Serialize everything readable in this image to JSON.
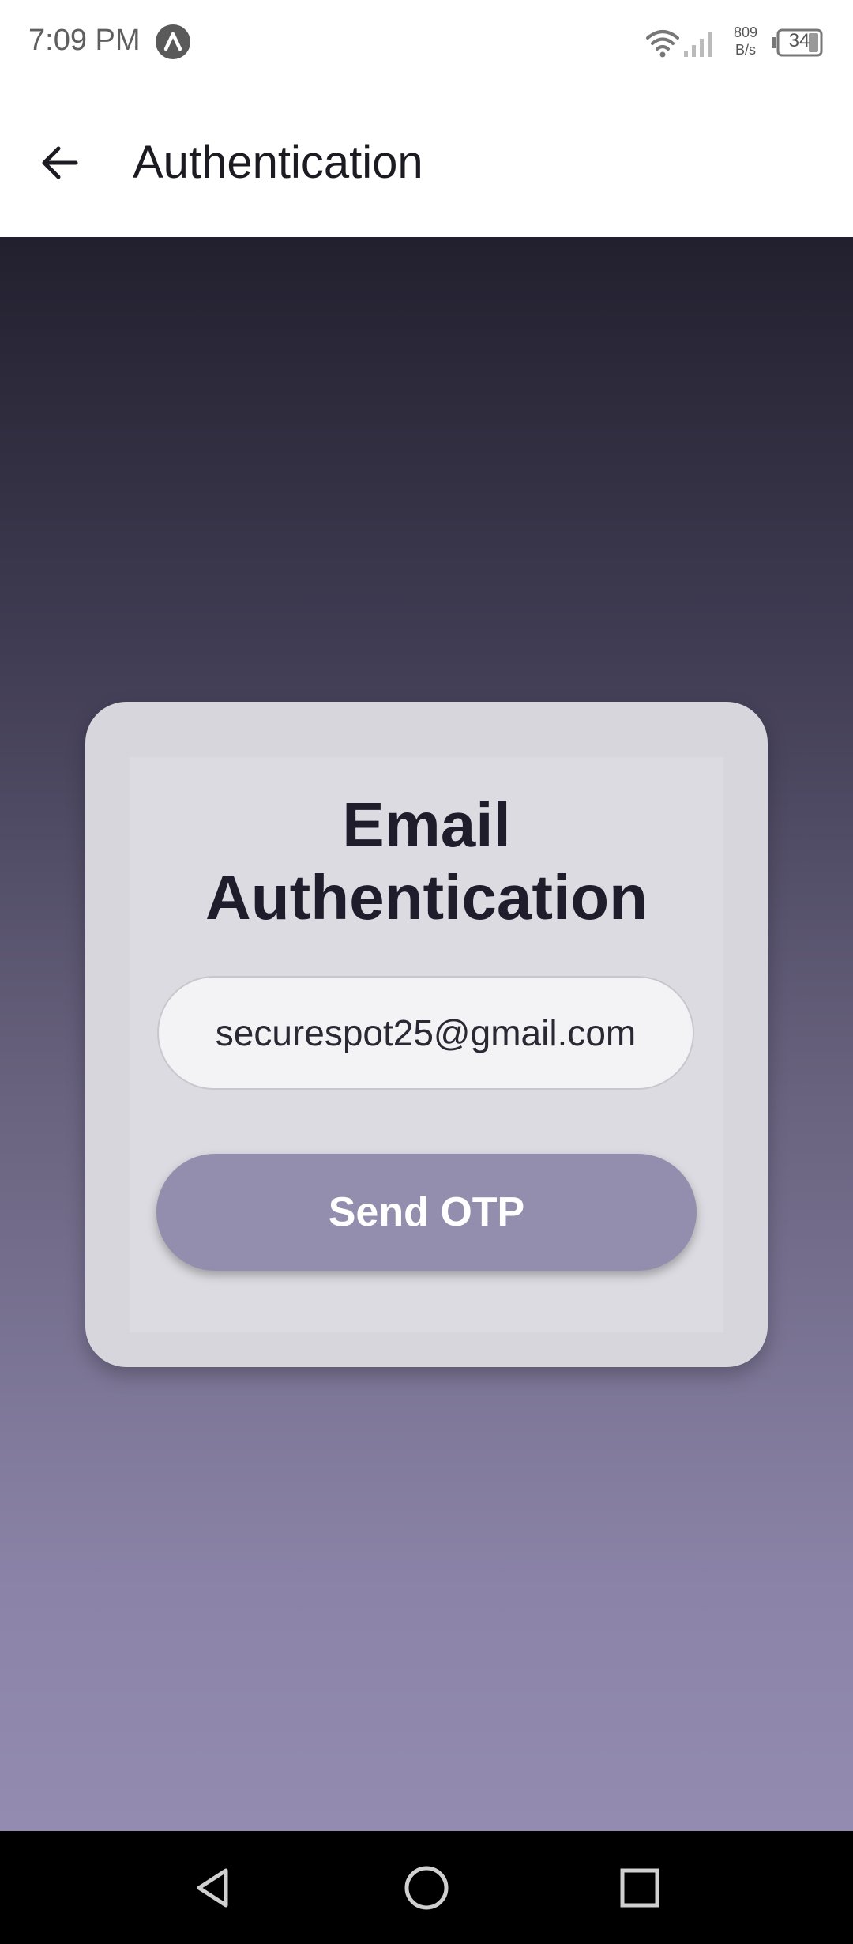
{
  "status_bar": {
    "time": "7:09 PM",
    "network_speed_value": "809",
    "network_speed_unit": "B/s",
    "battery_level": "34",
    "icons": [
      "app-notification-icon",
      "wifi-icon",
      "signal-icon",
      "battery-icon"
    ]
  },
  "app_bar": {
    "title": "Authentication",
    "back_icon": "arrow-left-icon"
  },
  "card": {
    "title": "Email Authentication",
    "email_value": "securespot25@gmail.com",
    "send_button_label": "Send OTP"
  },
  "nav_bar": {
    "icons": [
      "nav-back-icon",
      "nav-home-icon",
      "nav-recents-icon"
    ]
  },
  "colors": {
    "gradient_top": "#22202e",
    "gradient_bottom": "#938cb0",
    "card_background": "#d7d6dc",
    "button_background": "#938ead",
    "title_text": "#1f1d2b"
  }
}
